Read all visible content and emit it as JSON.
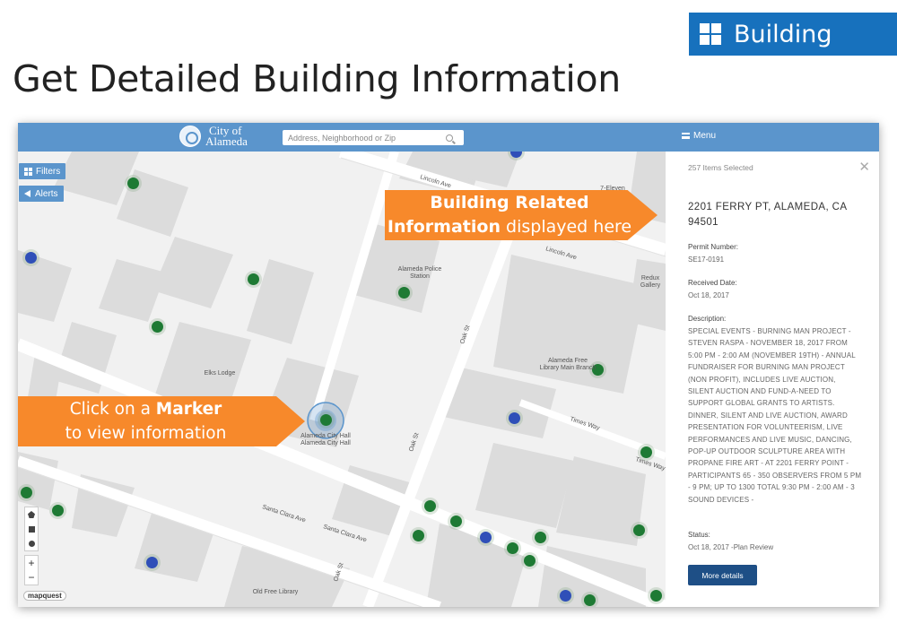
{
  "slide": {
    "badge_label": "Building",
    "title": "Get Detailed Building Information"
  },
  "topbar": {
    "logo_line1": "City of",
    "logo_line2": "Alameda",
    "search_placeholder": "Address, Neighborhood or Zip",
    "menu_label": "Menu"
  },
  "map": {
    "filters_label": "Filters",
    "alerts_label": "Alerts",
    "zoom_in": "+",
    "zoom_out": "−",
    "attribution": "mapquest",
    "streets": [
      "Lincoln Ave",
      "Oak St",
      "Oak St",
      "Santa Clara Ave",
      "Santa Clara Ave",
      "Oak St",
      "Times Way"
    ],
    "places": [
      "Alameda Police Station",
      "Elks Lodge",
      "Alameda City Hall",
      "Alameda City Hall",
      "Alameda Free Library Main Branch",
      "Old Free Library",
      "7-Eleven",
      "Redux Gallery"
    ],
    "colors": {
      "marker_green": "#1e7a34",
      "marker_blue": "#2f4fb8",
      "building": "#dcdcdc",
      "road": "#ffffff"
    }
  },
  "panel": {
    "items_selected": "257 Items Selected",
    "close": "✕",
    "address_line1": "2201 FERRY PT, ALAMEDA, CA",
    "address_line2": "94501",
    "permit_label": "Permit Number:",
    "permit_value": "SE17-0191",
    "received_label": "Received Date:",
    "received_value": "Oct 18, 2017",
    "description_label": "Description:",
    "description_value": "SPECIAL EVENTS - BURNING MAN PROJECT - STEVEN RASPA - NOVEMBER 18, 2017 FROM 5:00 PM - 2:00 AM (NOVEMBER 19TH) - ANNUAL FUNDRAISER FOR BURNING MAN PROJECT (NON PROFIT), INCLUDES LIVE AUCTION, SILENT AUCTION AND FUND-A-NEED TO SUPPORT GLOBAL GRANTS TO ARTISTS. DINNER, SILENT AND LIVE AUCTION, AWARD PRESENTATION FOR VOLUNTEERISM, LIVE PERFORMANCES AND LIVE MUSIC, DANCING, POP-UP OUTDOOR SCULPTURE AREA WITH PROPANE FIRE ART - AT 2201 FERRY POINT - PARTICIPANTS 65 - 350 OBSERVERS FROM 5 PM - 9 PM; UP TO 1300 TOTAL 9:30 PM - 2:00 AM - 3 SOUND DEVICES -",
    "status_label": "Status:",
    "status_value": "Oct 18, 2017 -Plan Review",
    "more_button": "More details"
  },
  "callouts": {
    "info_bold": "Building Related",
    "info_bold2": "Information",
    "info_rest": " displayed here",
    "click_pre": "Click on a ",
    "click_bold": "Marker",
    "click_rest": "to view information"
  }
}
